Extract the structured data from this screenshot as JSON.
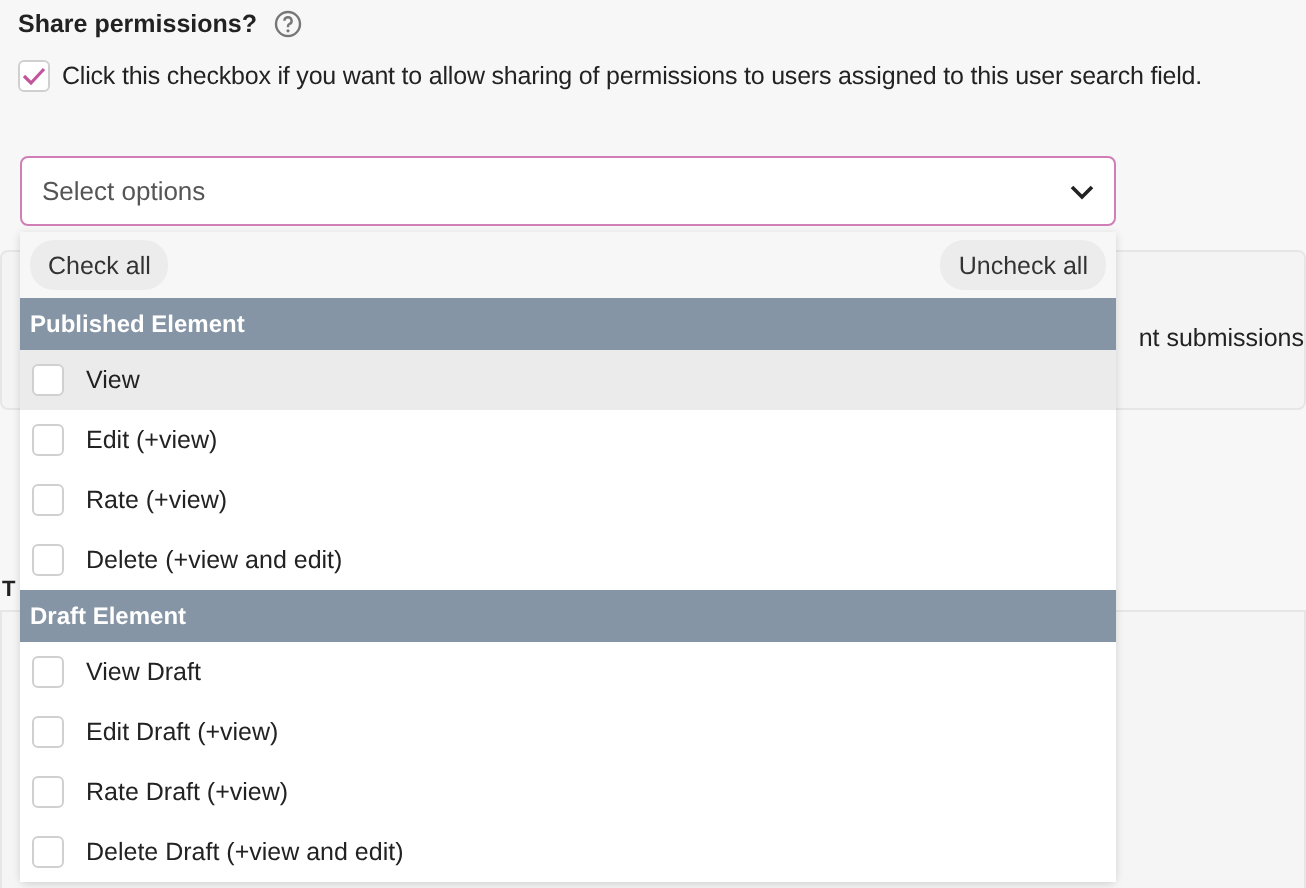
{
  "field": {
    "label": "Share permissions?",
    "checkbox": {
      "checked": true,
      "label": "Click this checkbox if you want to allow sharing of permissions to users assigned to this user search field."
    }
  },
  "select": {
    "placeholder": "Select options",
    "check_all": "Check all",
    "uncheck_all": "Uncheck all",
    "groups": [
      {
        "title": "Published Element",
        "options": [
          {
            "label": "View",
            "checked": false,
            "hovered": true
          },
          {
            "label": "Edit (+view)",
            "checked": false,
            "hovered": false
          },
          {
            "label": "Rate (+view)",
            "checked": false,
            "hovered": false
          },
          {
            "label": "Delete (+view and edit)",
            "checked": false,
            "hovered": false
          }
        ]
      },
      {
        "title": "Draft Element",
        "options": [
          {
            "label": "View Draft",
            "checked": false,
            "hovered": false
          },
          {
            "label": "Edit Draft (+view)",
            "checked": false,
            "hovered": false
          },
          {
            "label": "Rate Draft (+view)",
            "checked": false,
            "hovered": false
          },
          {
            "label": "Delete Draft (+view and edit)",
            "checked": false,
            "hovered": false
          }
        ]
      }
    ]
  },
  "background": {
    "text_1": "nt submissions",
    "text_2": "T"
  }
}
